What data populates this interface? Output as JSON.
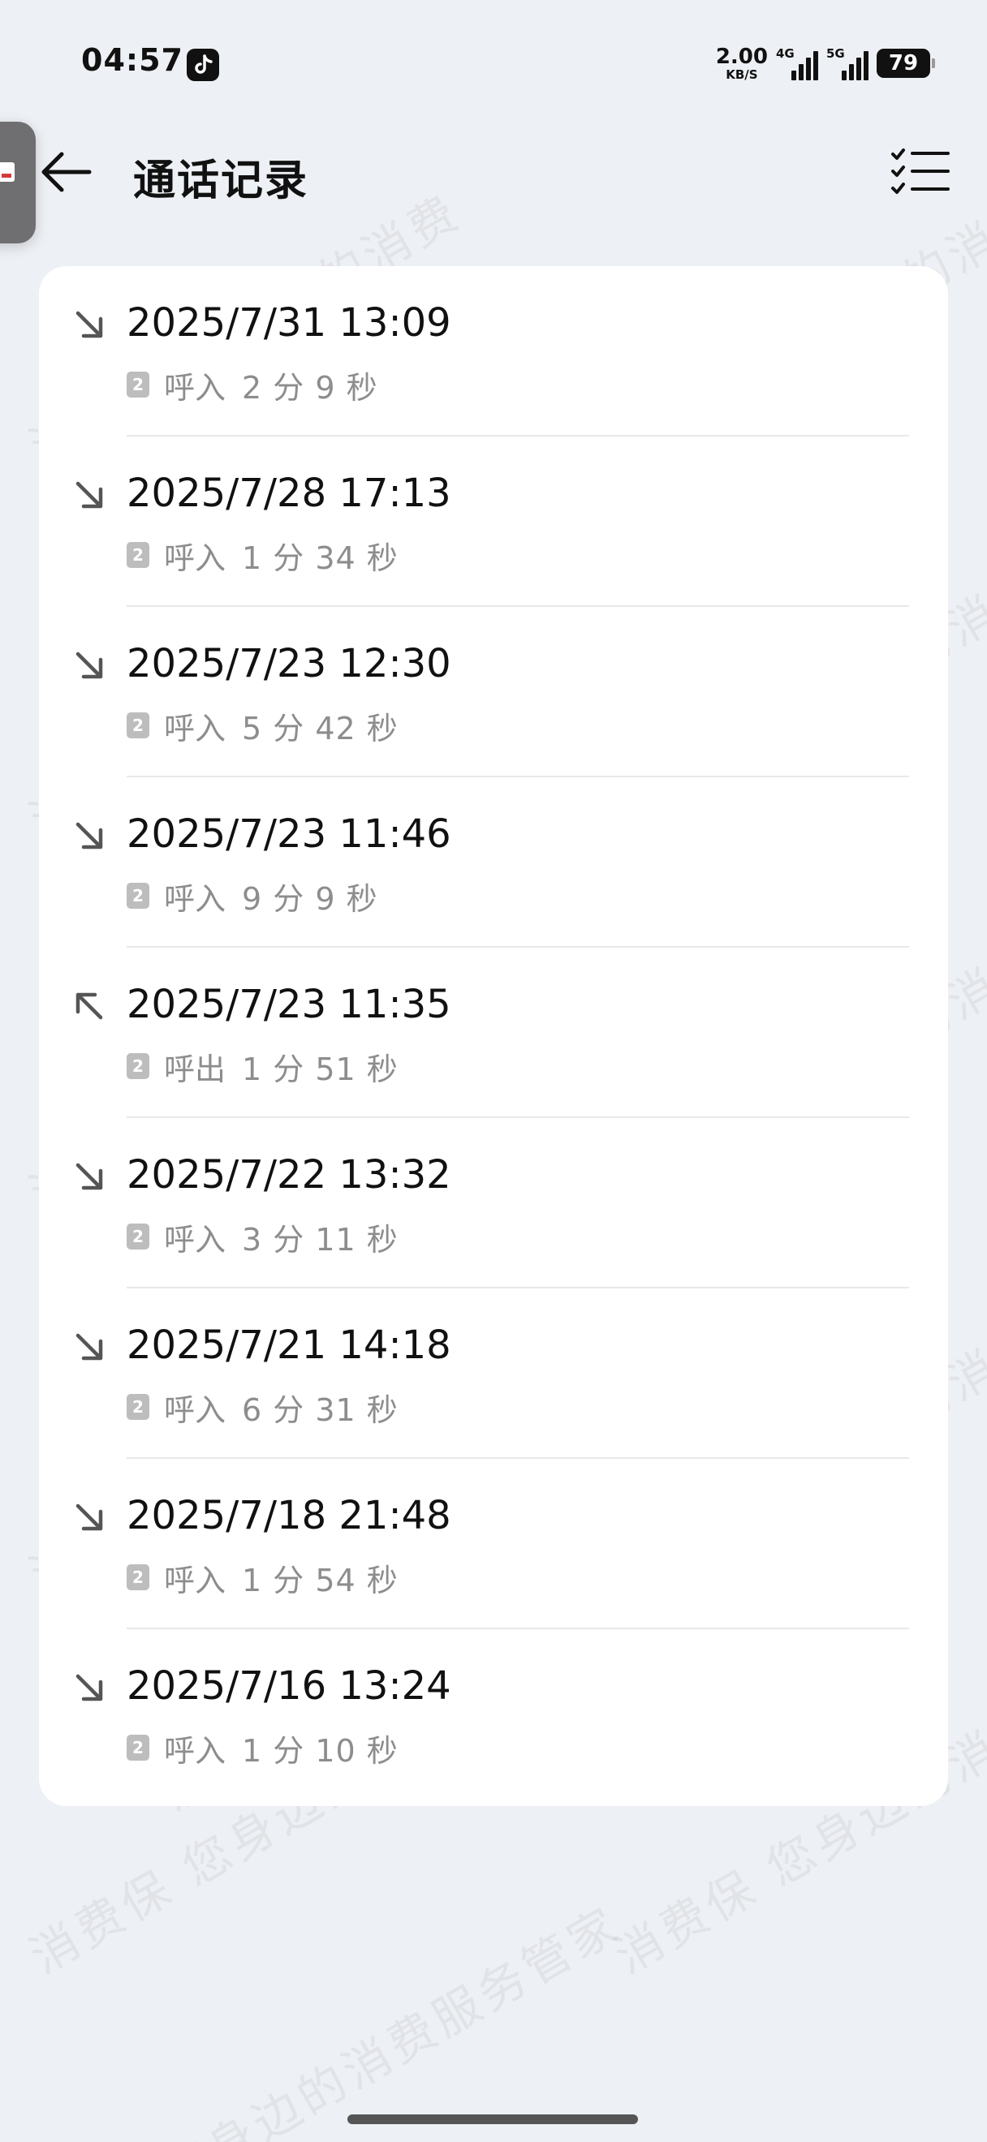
{
  "status_bar": {
    "time": "04:57",
    "net_speed": "2.00",
    "net_speed_unit": "KB/S",
    "signal_1": "4G",
    "signal_2": "5G",
    "battery": "79"
  },
  "header": {
    "title": "通话记录",
    "back_icon": "arrow-left-icon",
    "select_icon": "checklist-icon"
  },
  "calls": [
    {
      "date": "2025/7/31 13:09",
      "sim": "2",
      "type": "呼入",
      "duration": "2 分 9 秒",
      "direction": "incoming"
    },
    {
      "date": "2025/7/28 17:13",
      "sim": "2",
      "type": "呼入",
      "duration": "1 分 34 秒",
      "direction": "incoming"
    },
    {
      "date": "2025/7/23 12:30",
      "sim": "2",
      "type": "呼入",
      "duration": "5 分 42 秒",
      "direction": "incoming"
    },
    {
      "date": "2025/7/23 11:46",
      "sim": "2",
      "type": "呼入",
      "duration": "9 分 9 秒",
      "direction": "incoming"
    },
    {
      "date": "2025/7/23 11:35",
      "sim": "2",
      "type": "呼出",
      "duration": "1 分 51 秒",
      "direction": "outgoing"
    },
    {
      "date": "2025/7/22 13:32",
      "sim": "2",
      "type": "呼入",
      "duration": "3 分 11 秒",
      "direction": "incoming"
    },
    {
      "date": "2025/7/21 14:18",
      "sim": "2",
      "type": "呼入",
      "duration": "6 分 31 秒",
      "direction": "incoming"
    },
    {
      "date": "2025/7/18 21:48",
      "sim": "2",
      "type": "呼入",
      "duration": "1 分 54 秒",
      "direction": "incoming"
    },
    {
      "date": "2025/7/16 13:24",
      "sim": "2",
      "type": "呼入",
      "duration": "1 分 10 秒",
      "direction": "incoming"
    }
  ],
  "watermark": {
    "text_a": "消费保 您身边的消费",
    "text_b": "您身边的消费服务管家"
  },
  "colors": {
    "background": "#edf0f4",
    "card": "#ffffff",
    "secondary_text": "#8d8d8d",
    "sim_badge": "#bdbdbd"
  }
}
